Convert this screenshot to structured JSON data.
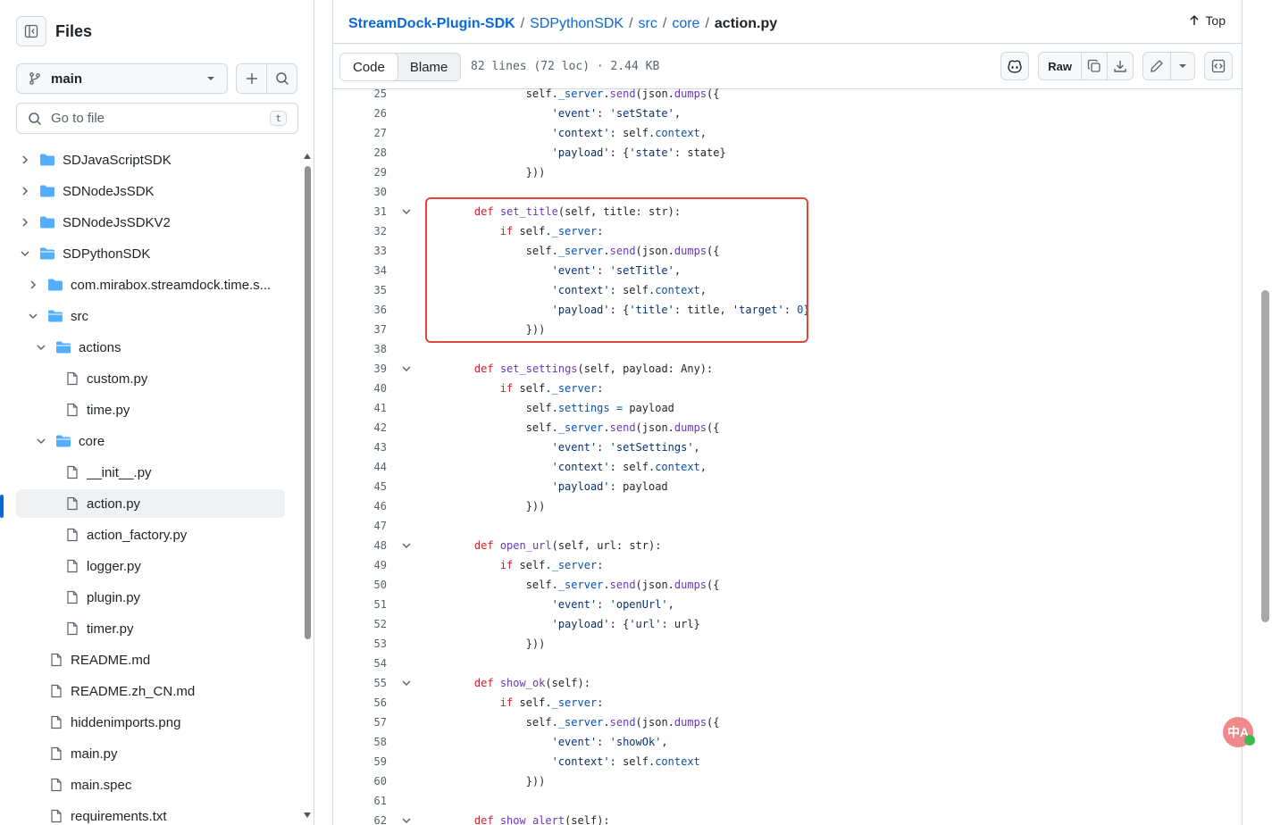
{
  "sidebar": {
    "title": "Files",
    "branch": "main",
    "goto_placeholder": "Go to file",
    "goto_shortcut": "t",
    "items": [
      {
        "label": "SDJavaScriptSDK",
        "type": "folder",
        "depth": 0,
        "expanded": false
      },
      {
        "label": "SDNodeJsSDK",
        "type": "folder",
        "depth": 0,
        "expanded": false
      },
      {
        "label": "SDNodeJsSDKV2",
        "type": "folder",
        "depth": 0,
        "expanded": false
      },
      {
        "label": "SDPythonSDK",
        "type": "folder",
        "depth": 0,
        "expanded": true
      },
      {
        "label": "com.mirabox.streamdock.time.s...",
        "type": "folder",
        "depth": 1,
        "expanded": false
      },
      {
        "label": "src",
        "type": "folder",
        "depth": 1,
        "expanded": true
      },
      {
        "label": "actions",
        "type": "folder",
        "depth": 2,
        "expanded": true
      },
      {
        "label": "custom.py",
        "type": "file",
        "depth": 3
      },
      {
        "label": "time.py",
        "type": "file",
        "depth": 3
      },
      {
        "label": "core",
        "type": "folder",
        "depth": 2,
        "expanded": true
      },
      {
        "label": "__init__.py",
        "type": "file",
        "depth": 3
      },
      {
        "label": "action.py",
        "type": "file",
        "depth": 3,
        "active": true
      },
      {
        "label": "action_factory.py",
        "type": "file",
        "depth": 3
      },
      {
        "label": "logger.py",
        "type": "file",
        "depth": 3
      },
      {
        "label": "plugin.py",
        "type": "file",
        "depth": 3
      },
      {
        "label": "timer.py",
        "type": "file",
        "depth": 3
      },
      {
        "label": "README.md",
        "type": "file",
        "depth": 1
      },
      {
        "label": "README.zh_CN.md",
        "type": "file",
        "depth": 1
      },
      {
        "label": "hiddenimports.png",
        "type": "file",
        "depth": 1
      },
      {
        "label": "main.py",
        "type": "file",
        "depth": 1
      },
      {
        "label": "main.spec",
        "type": "file",
        "depth": 1
      },
      {
        "label": "requirements.txt",
        "type": "file",
        "depth": 1
      }
    ]
  },
  "breadcrumb": {
    "repo": "StreamDock-Plugin-SDK",
    "parts": [
      "SDPythonSDK",
      "src",
      "core"
    ],
    "current": "action.py",
    "separator": "/"
  },
  "top_label": "Top",
  "file_header": {
    "tab_code": "Code",
    "tab_blame": "Blame",
    "meta": "82 lines (72 loc) · 2.44 KB",
    "raw_label": "Raw"
  },
  "code_lines": [
    {
      "n": "25",
      "fold": false,
      "html": "        self.<span class='at'>_server</span>.<span class='fn'>send</span>(json.<span class='fn'>dumps</span>({"
    },
    {
      "n": "26",
      "fold": false,
      "html": "            <span class='st'>'event'</span>: <span class='st'>'setState'</span>,"
    },
    {
      "n": "27",
      "fold": false,
      "html": "            <span class='st'>'context'</span>: self.<span class='at'>context</span>,"
    },
    {
      "n": "28",
      "fold": false,
      "html": "            <span class='st'>'payload'</span>: {<span class='st'>'state'</span>: state}"
    },
    {
      "n": "29",
      "fold": false,
      "html": "        }))"
    },
    {
      "n": "30",
      "fold": false,
      "html": ""
    },
    {
      "n": "31",
      "fold": true,
      "html": "<span class='kw'>def</span> <span class='fn'>set_title</span>(self, title: str):"
    },
    {
      "n": "32",
      "fold": false,
      "html": "    <span class='kw'>if</span> self.<span class='at'>_server</span>:"
    },
    {
      "n": "33",
      "fold": false,
      "html": "        self.<span class='at'>_server</span>.<span class='fn'>send</span>(json.<span class='fn'>dumps</span>({"
    },
    {
      "n": "34",
      "fold": false,
      "html": "            <span class='st'>'event'</span>: <span class='st'>'setTitle'</span>,"
    },
    {
      "n": "35",
      "fold": false,
      "html": "            <span class='st'>'context'</span>: self.<span class='at'>context</span>,"
    },
    {
      "n": "36",
      "fold": false,
      "html": "            <span class='st'>'payload'</span>: {<span class='st'>'title'</span>: title, <span class='st'>'target'</span>: <span class='nu'>0</span>}"
    },
    {
      "n": "37",
      "fold": false,
      "html": "        }))"
    },
    {
      "n": "38",
      "fold": false,
      "html": ""
    },
    {
      "n": "39",
      "fold": true,
      "html": "<span class='kw'>def</span> <span class='fn'>set_settings</span>(self, payload: Any):"
    },
    {
      "n": "40",
      "fold": false,
      "html": "    <span class='kw'>if</span> self.<span class='at'>_server</span>:"
    },
    {
      "n": "41",
      "fold": false,
      "html": "        self.<span class='at'>settings</span> <span class='at'>=</span> payload"
    },
    {
      "n": "42",
      "fold": false,
      "html": "        self.<span class='at'>_server</span>.<span class='fn'>send</span>(json.<span class='fn'>dumps</span>({"
    },
    {
      "n": "43",
      "fold": false,
      "html": "            <span class='st'>'event'</span>: <span class='st'>'setSettings'</span>,"
    },
    {
      "n": "44",
      "fold": false,
      "html": "            <span class='st'>'context'</span>: self.<span class='at'>context</span>,"
    },
    {
      "n": "45",
      "fold": false,
      "html": "            <span class='st'>'payload'</span>: payload"
    },
    {
      "n": "46",
      "fold": false,
      "html": "        }))"
    },
    {
      "n": "47",
      "fold": false,
      "html": ""
    },
    {
      "n": "48",
      "fold": true,
      "html": "<span class='kw'>def</span> <span class='fn'>open_url</span>(self, url: str):"
    },
    {
      "n": "49",
      "fold": false,
      "html": "    <span class='kw'>if</span> self.<span class='at'>_server</span>:"
    },
    {
      "n": "50",
      "fold": false,
      "html": "        self.<span class='at'>_server</span>.<span class='fn'>send</span>(json.<span class='fn'>dumps</span>({"
    },
    {
      "n": "51",
      "fold": false,
      "html": "            <span class='st'>'event'</span>: <span class='st'>'openUrl'</span>,"
    },
    {
      "n": "52",
      "fold": false,
      "html": "            <span class='st'>'payload'</span>: {<span class='st'>'url'</span>: url}"
    },
    {
      "n": "53",
      "fold": false,
      "html": "        }))"
    },
    {
      "n": "54",
      "fold": false,
      "html": ""
    },
    {
      "n": "55",
      "fold": true,
      "html": "<span class='kw'>def</span> <span class='fn'>show_ok</span>(self):"
    },
    {
      "n": "56",
      "fold": false,
      "html": "    <span class='kw'>if</span> self.<span class='at'>_server</span>:"
    },
    {
      "n": "57",
      "fold": false,
      "html": "        self.<span class='at'>_server</span>.<span class='fn'>send</span>(json.<span class='fn'>dumps</span>({"
    },
    {
      "n": "58",
      "fold": false,
      "html": "            <span class='st'>'event'</span>: <span class='st'>'showOk'</span>,"
    },
    {
      "n": "59",
      "fold": false,
      "html": "            <span class='st'>'context'</span>: self.<span class='at'>context</span>"
    },
    {
      "n": "60",
      "fold": false,
      "html": "        }))"
    },
    {
      "n": "61",
      "fold": false,
      "html": ""
    },
    {
      "n": "62",
      "fold": true,
      "html": "<span class='kw'>def</span> <span class='fn'>show_alert</span>(self):"
    }
  ],
  "translate_badge": "中A",
  "colors": {
    "link": "#0969da",
    "keyword": "#cf222e",
    "function": "#6639ba",
    "string": "#0a3069",
    "highlight_box": "#e0473c"
  }
}
